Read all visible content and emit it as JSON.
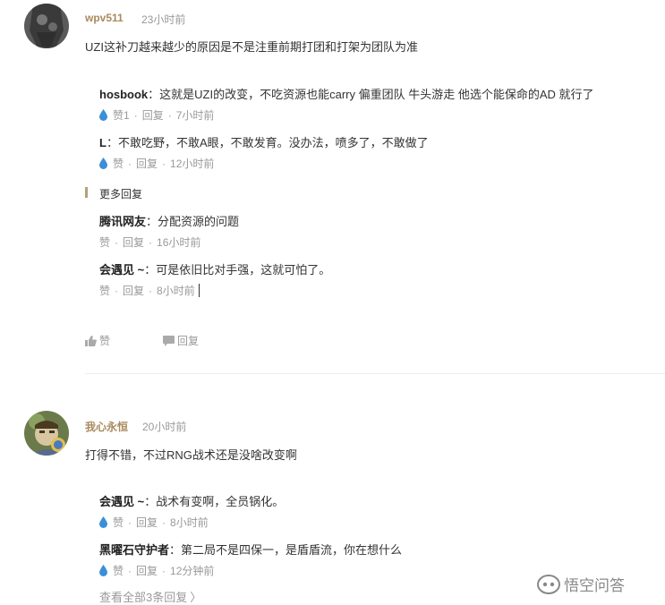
{
  "comments": [
    {
      "username": "wpv511",
      "time": "23小时前",
      "text": "UZI这补刀越来越少的原因是不是注重前期打团和打架为团队为准",
      "replies": [
        {
          "name": "hosbook",
          "text": "：这就是UZI的改变，不吃资源也能carry 偏重团队 牛头游走 他选个能保命的AD 就行了",
          "like": "赞1",
          "reply": "回复",
          "time": "7小时前"
        },
        {
          "name": "L",
          "text": "：不敢吃野，不敢A眼，不敢发育。没办法，喷多了，不敢做了",
          "like": "赞",
          "reply": "回复",
          "time": "12小时前"
        }
      ],
      "more_label": "更多回复",
      "more_replies": [
        {
          "name": "腾讯网友",
          "text": "：分配资源的问题",
          "like": "赞",
          "reply": "回复",
          "time": "16小时前"
        },
        {
          "name": "会遇见 ~",
          "text": "：可是依旧比对手强，这就可怕了。",
          "like": "赞",
          "reply": "回复",
          "time": "8小时前"
        }
      ],
      "like_action": "赞",
      "reply_action": "回复"
    },
    {
      "username": "我心永恒",
      "time": "20小时前",
      "text": "打得不错，不过RNG战术还是没啥改变啊",
      "replies": [
        {
          "name": "会遇见 ~",
          "text": "：战术有变啊，全员锅化。",
          "like": "赞",
          "reply": "回复",
          "time": "8小时前"
        },
        {
          "name": "黑曜石守护者",
          "text": "：第二局不是四保一，是盾盾流，你在想什么",
          "like": "赞",
          "reply": "回复",
          "time": "12分钟前"
        }
      ],
      "view_all": "查看全部3条回复"
    }
  ],
  "separator": "·",
  "watermark": "悟空问答",
  "colors": {
    "username": "#a88a5e",
    "accent": "#3a8fd9",
    "muted": "#999999"
  }
}
